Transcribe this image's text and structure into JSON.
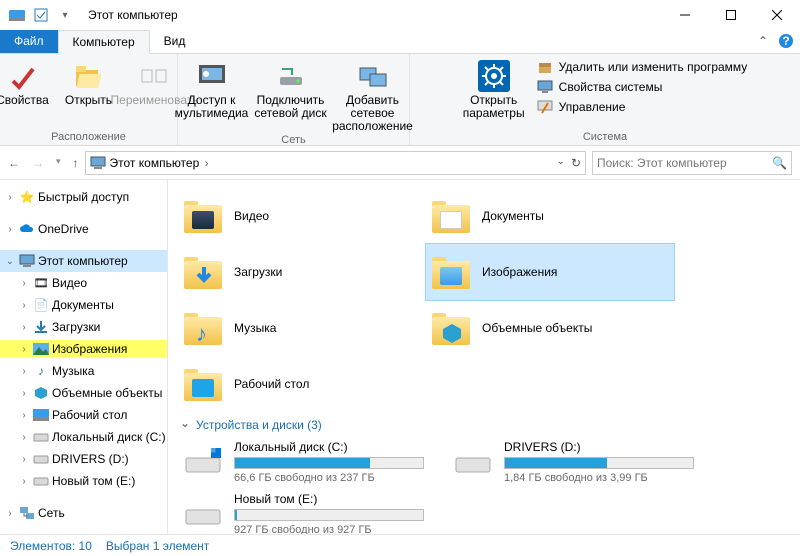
{
  "window": {
    "title": "Этот компьютер"
  },
  "tabs": {
    "file": "Файл",
    "computer": "Компьютер",
    "view": "Вид"
  },
  "ribbon": {
    "location": {
      "props": "Свойства",
      "open": "Открыть",
      "rename": "Переименовать",
      "group": "Расположение"
    },
    "network": {
      "media": "Доступ к мультимедиа",
      "netdrive": "Подключить сетевой диск",
      "netloc": "Добавить сетевое расположение",
      "group": "Сеть"
    },
    "system": {
      "settings": "Открыть параметры",
      "uninstall": "Удалить или изменить программу",
      "sysprops": "Свойства системы",
      "manage": "Управление",
      "group": "Система"
    }
  },
  "nav": {
    "crumb1": "Этот компьютер",
    "search_placeholder": "Поиск: Этот компьютер"
  },
  "tree": {
    "quick": "Быстрый доступ",
    "onedrive": "OneDrive",
    "thispc": "Этот компьютер",
    "video": "Видео",
    "docs": "Документы",
    "downloads": "Загрузки",
    "pictures": "Изображения",
    "music": "Музыка",
    "objects3d": "Объемные объекты",
    "desktop": "Рабочий стол",
    "localdisk": "Локальный диск (C:)",
    "drivers": "DRIVERS (D:)",
    "newvol": "Новый том (E:)",
    "network": "Сеть"
  },
  "folders": {
    "video": "Видео",
    "docs": "Документы",
    "downloads": "Загрузки",
    "pictures": "Изображения",
    "music": "Музыка",
    "objects3d": "Объемные объекты",
    "desktop": "Рабочий стол"
  },
  "section_drives": "Устройства и диски (3)",
  "drives": {
    "c": {
      "name": "Локальный диск (C:)",
      "sub": "66,6 ГБ свободно из 237 ГБ",
      "fill": 72
    },
    "d": {
      "name": "DRIVERS (D:)",
      "sub": "1,84 ГБ свободно из 3,99 ГБ",
      "fill": 54
    },
    "e": {
      "name": "Новый том (E:)",
      "sub": "927 ГБ свободно из 927 ГБ",
      "fill": 1
    }
  },
  "status": {
    "count": "Элементов: 10",
    "selected": "Выбран 1 элемент"
  }
}
